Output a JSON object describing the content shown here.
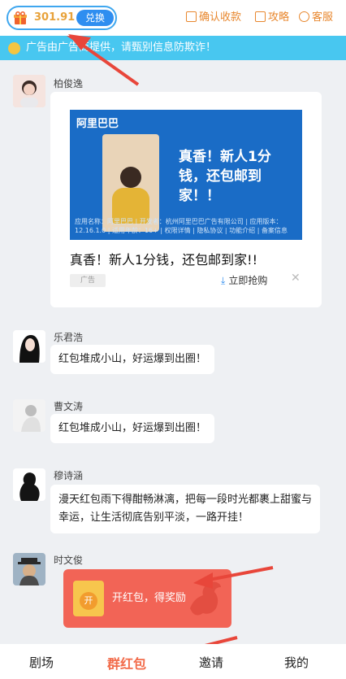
{
  "header": {
    "coin_value": "301.91",
    "exchange_label": "兑换",
    "confirm_receipt": "确认收款",
    "guide": "攻略",
    "support": "客服"
  },
  "notice": {
    "text": "广告由广告商提供，请甄别信息防欺诈！"
  },
  "messages": [
    {
      "name": "柏俊逸"
    },
    {
      "name": "乐君浩",
      "text": "红包堆成小山，好运爆到出圈！"
    },
    {
      "name": "曹文涛",
      "text": "红包堆成小山，好运爆到出圈！"
    },
    {
      "name": "穆诗涵",
      "text": "漫天红包雨下得酣畅淋漓，把每一段时光都裹上甜蜜与幸运，让生活彻底告别平淡，一路开挂！"
    },
    {
      "name": "时文俊"
    }
  ],
  "ad": {
    "brand": "阿里巴巴",
    "headline": "真香！新人1分钱，还包邮到家！！",
    "fine_print": "应用名称：阿里巴巴 | 开发者：杭州阿里巴巴广告有限公司 | 应用版本：12.16.1.0 | 适用年龄：16+ | 权限详情 | 隐私协议 | 功能介绍 | 备案信息",
    "title": "真香！新人1分钱，还包邮到家!!",
    "tag": "广告",
    "grab_label": "立即抢购",
    "close_glyph": "✕",
    "download_glyph": "⤓"
  },
  "red_packet": {
    "seal": "开",
    "text": "开红包，得奖励"
  },
  "tabs": [
    {
      "label": "剧场"
    },
    {
      "label": "群红包"
    },
    {
      "label": "邀请"
    },
    {
      "label": "我的"
    }
  ],
  "colors": {
    "accent_blue": "#2f8ef0",
    "orange": "#e8872e",
    "red_packet": "#f26456",
    "active_tab": "#f26b4a",
    "notice_bg": "#48c7f0"
  },
  "icons": [
    "gift-icon",
    "confirm-receipt-icon",
    "guide-icon",
    "support-icon",
    "speaker-icon",
    "download-icon",
    "close-icon",
    "horse-icon"
  ]
}
